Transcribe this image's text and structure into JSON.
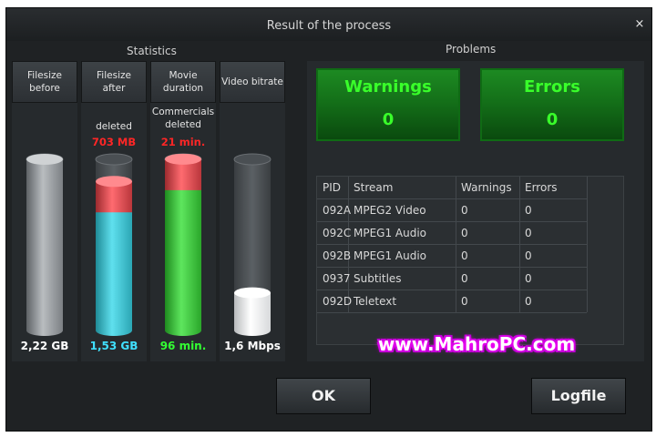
{
  "window": {
    "title": "Result of the process",
    "close_glyph": "×"
  },
  "statistics": {
    "label": "Statistics",
    "columns": [
      {
        "header_line1": "Filesize",
        "header_line2": "before",
        "value": "2,22 GB",
        "value_color": "#ffffff",
        "fill_level": 1.0,
        "fill_color": "grey",
        "note_line1": "",
        "note_line2": "",
        "note_red": ""
      },
      {
        "header_line1": "Filesize",
        "header_line2": "after",
        "value": "1,53 GB",
        "value_color": "#40e0ff",
        "fill_level": 0.69,
        "fill_color": "cyan",
        "note_line1": "deleted",
        "note_line2": "",
        "note_red": "703 MB"
      },
      {
        "header_line1": "Movie",
        "header_line2": "duration",
        "value": "96 min.",
        "value_color": "#33ff33",
        "fill_level": 0.82,
        "fill_color": "green",
        "note_line1": "Commercials",
        "note_line2": "deleted",
        "note_red": "21 min."
      },
      {
        "header_line1": "Video bitrate",
        "header_line2": "",
        "value": "1,6 Mbps",
        "value_color": "#ffffff",
        "fill_level": 0.22,
        "fill_color": "white",
        "note_line1": "",
        "note_line2": "",
        "note_red": ""
      }
    ]
  },
  "problems": {
    "label": "Problems",
    "warnings_title": "Warnings",
    "warnings_count": "0",
    "errors_title": "Errors",
    "errors_count": "0",
    "table": {
      "headers": [
        "PID",
        "Stream",
        "Warnings",
        "Errors"
      ],
      "rows": [
        [
          "092A",
          "MPEG2 Video",
          "0",
          "0"
        ],
        [
          "092C",
          "MPEG1 Audio",
          "0",
          "0"
        ],
        [
          "092B",
          "MPEG1 Audio",
          "0",
          "0"
        ],
        [
          "0937",
          "Subtitles",
          "0",
          "0"
        ],
        [
          "092D",
          "Teletext",
          "0",
          "0"
        ]
      ]
    }
  },
  "buttons": {
    "ok": "OK",
    "logfile": "Logfile"
  },
  "watermark": "www.MahroPC.com"
}
